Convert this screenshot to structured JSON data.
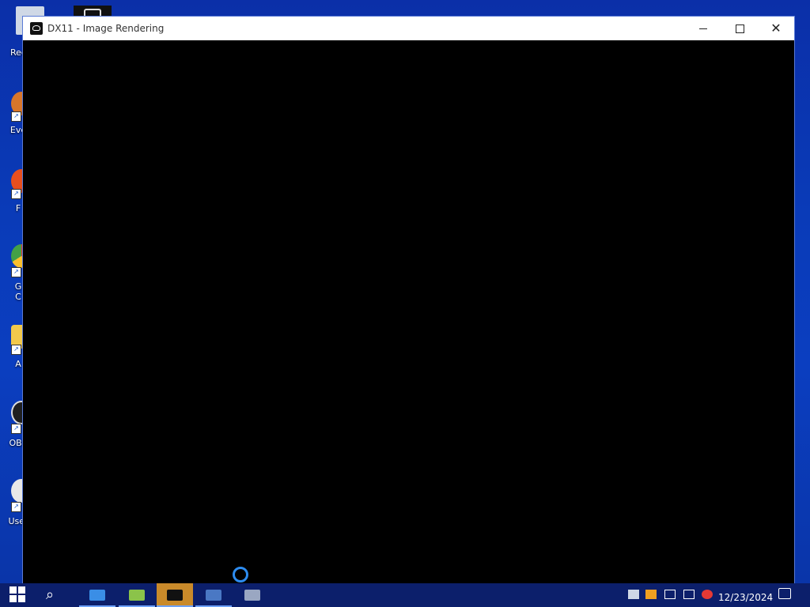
{
  "window": {
    "title": "DX11 - Image Rendering"
  },
  "desktop": {
    "icons": [
      {
        "label": "Rec",
        "name": "desktop-icon-recycle-bin",
        "color": "#cfd8e6"
      },
      {
        "label": "Eve",
        "name": "desktop-icon-eve",
        "color": "#d8762a"
      },
      {
        "label": "F",
        "name": "desktop-icon-firefox",
        "color": "#e84f1e"
      },
      {
        "label": "G\nC",
        "name": "desktop-icon-google-chrome",
        "color": "#3aa757"
      },
      {
        "label": "A",
        "name": "desktop-icon-folder",
        "color": "#f2c94c"
      },
      {
        "label": "OBS",
        "name": "desktop-icon-obs",
        "color": "#202020"
      },
      {
        "label": "User",
        "name": "desktop-icon-user",
        "color": "#e8e8e8"
      }
    ]
  },
  "taskbar": {
    "clock_date": "12/23/2024",
    "items": [
      {
        "name": "taskbar-item-file-explorer",
        "color": "#3a8ee6",
        "active": false
      },
      {
        "name": "taskbar-item-app-green",
        "color": "#8bc34a",
        "active": false
      },
      {
        "name": "taskbar-item-dx11-app",
        "color": "#111111",
        "active": true
      },
      {
        "name": "taskbar-item-app-blue",
        "color": "#4a78c4",
        "active": false
      },
      {
        "name": "taskbar-item-app-grey",
        "color": "#9aa7c2",
        "active": false
      }
    ]
  },
  "colors": {
    "desktop_bg": "#0b3ec0",
    "taskbar_bg": "#0c1f6b",
    "spinner": "#2d8cf0",
    "active_task": "#c98a2a"
  }
}
